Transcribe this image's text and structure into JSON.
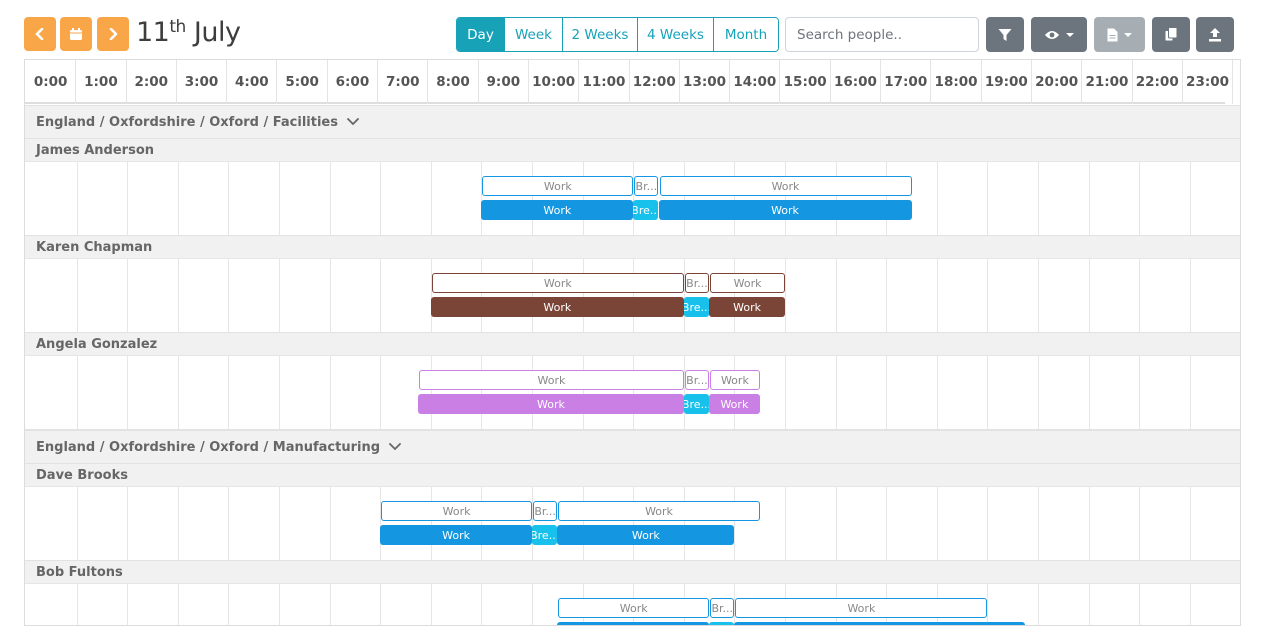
{
  "toolbar": {
    "title_day": "11",
    "title_suffix": "th",
    "title_month": "July",
    "views": [
      "Day",
      "Week",
      "2 Weeks",
      "4 Weeks",
      "Month"
    ],
    "active_view": "Day",
    "search_placeholder": "Search people.."
  },
  "colors": {
    "accent_orange": "#f9a648",
    "view_teal": "#17a2b8",
    "break": "#17c1eb"
  },
  "hours": [
    "0:00",
    "1:00",
    "2:00",
    "3:00",
    "4:00",
    "5:00",
    "6:00",
    "7:00",
    "8:00",
    "9:00",
    "10:00",
    "11:00",
    "12:00",
    "13:00",
    "14:00",
    "15:00",
    "16:00",
    "17:00",
    "18:00",
    "19:00",
    "20:00",
    "21:00",
    "22:00",
    "23:00"
  ],
  "groups": [
    {
      "label": "England / Oxfordshire / Oxford / Facilities",
      "people": [
        {
          "name": "James Anderson",
          "color": "#1497e0",
          "outline_color": "#1497e0",
          "planned": [
            {
              "label": "Work",
              "start": 9.0,
              "end": 12.0
            },
            {
              "label": "Br...",
              "start": 12.0,
              "end": 12.5
            },
            {
              "label": "Work",
              "start": 12.5,
              "end": 17.5
            }
          ],
          "actual": [
            {
              "label": "Work",
              "start": 9.0,
              "end": 12.0,
              "kind": "work"
            },
            {
              "label": "Bre...",
              "start": 12.0,
              "end": 12.5,
              "kind": "break"
            },
            {
              "label": "Work",
              "start": 12.5,
              "end": 17.5,
              "kind": "work"
            }
          ]
        },
        {
          "name": "Karen Chapman",
          "color": "#7a4437",
          "outline_color": "#7a4437",
          "planned": [
            {
              "label": "Work",
              "start": 8.0,
              "end": 13.0
            },
            {
              "label": "Br...",
              "start": 13.0,
              "end": 13.5
            },
            {
              "label": "Work",
              "start": 13.5,
              "end": 15.0
            }
          ],
          "actual": [
            {
              "label": "Work",
              "start": 8.0,
              "end": 13.0,
              "kind": "work"
            },
            {
              "label": "Bre...",
              "start": 13.0,
              "end": 13.5,
              "kind": "break"
            },
            {
              "label": "Work",
              "start": 13.5,
              "end": 15.0,
              "kind": "work"
            }
          ]
        },
        {
          "name": "Angela Gonzalez",
          "color": "#c97fe4",
          "outline_color": "#c97fe4",
          "planned": [
            {
              "label": "Work",
              "start": 7.75,
              "end": 13.0
            },
            {
              "label": "Br...",
              "start": 13.0,
              "end": 13.5
            },
            {
              "label": "Work",
              "start": 13.5,
              "end": 14.5
            }
          ],
          "actual": [
            {
              "label": "Work",
              "start": 7.75,
              "end": 13.0,
              "kind": "work"
            },
            {
              "label": "Bre...",
              "start": 13.0,
              "end": 13.5,
              "kind": "break"
            },
            {
              "label": "Work",
              "start": 13.5,
              "end": 14.5,
              "kind": "work"
            }
          ]
        }
      ]
    },
    {
      "label": "England / Oxfordshire / Oxford / Manufacturing",
      "people": [
        {
          "name": "Dave Brooks",
          "color": "#1497e0",
          "outline_color": "#1497e0",
          "planned": [
            {
              "label": "Work",
              "start": 7.0,
              "end": 10.0
            },
            {
              "label": "Br...",
              "start": 10.0,
              "end": 10.5
            },
            {
              "label": "Work",
              "start": 10.5,
              "end": 14.5
            }
          ],
          "actual": [
            {
              "label": "Work",
              "start": 7.0,
              "end": 10.0,
              "kind": "work"
            },
            {
              "label": "Bre...",
              "start": 10.0,
              "end": 10.5,
              "kind": "break"
            },
            {
              "label": "Work",
              "start": 10.5,
              "end": 14.0,
              "kind": "work"
            }
          ]
        },
        {
          "name": "Bob Fultons",
          "color": "#1497e0",
          "outline_color": "#1497e0",
          "planned": [
            {
              "label": "Work",
              "start": 10.5,
              "end": 13.5
            },
            {
              "label": "Br...",
              "start": 13.5,
              "end": 14.0
            },
            {
              "label": "Work",
              "start": 14.0,
              "end": 19.0
            }
          ],
          "actual": [
            {
              "label": "",
              "start": 10.5,
              "end": 13.5,
              "kind": "work"
            },
            {
              "label": "",
              "start": 13.5,
              "end": 14.0,
              "kind": "break"
            },
            {
              "label": "",
              "start": 14.0,
              "end": 19.75,
              "kind": "work"
            }
          ]
        }
      ]
    }
  ]
}
